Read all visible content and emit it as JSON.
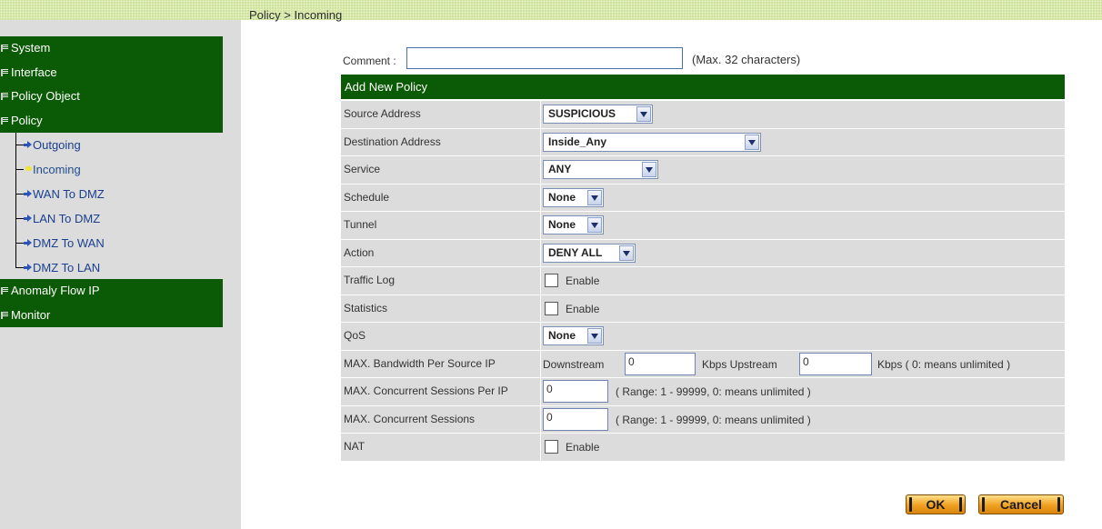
{
  "breadcrumb": "Policy > Incoming",
  "sidebar": {
    "top_items": [
      "System",
      "Interface",
      "Policy Object",
      "Policy"
    ],
    "sub_items": [
      {
        "label": "Outgoing",
        "active": false
      },
      {
        "label": "Incoming",
        "active": true
      },
      {
        "label": "WAN To DMZ",
        "active": false
      },
      {
        "label": "LAN To DMZ",
        "active": false
      },
      {
        "label": "DMZ To WAN",
        "active": false
      },
      {
        "label": "DMZ To LAN",
        "active": false
      }
    ],
    "bottom_items": [
      "Anomaly Flow IP",
      "Monitor"
    ]
  },
  "comment": {
    "label": "Comment :",
    "value": "",
    "hint": "(Max. 32 characters)"
  },
  "panel": {
    "title": "Add New Policy",
    "source_address": {
      "label": "Source Address",
      "value": "SUSPICIOUS"
    },
    "destination_address": {
      "label": "Destination Address",
      "value": "Inside_Any"
    },
    "service": {
      "label": "Service",
      "value": "ANY"
    },
    "schedule": {
      "label": "Schedule",
      "value": "None"
    },
    "tunnel": {
      "label": "Tunnel",
      "value": "None"
    },
    "action": {
      "label": "Action",
      "value": "DENY ALL"
    },
    "traffic_log": {
      "label": "Traffic Log",
      "checkbox_label": "Enable",
      "checked": false
    },
    "statistics": {
      "label": "Statistics",
      "checkbox_label": "Enable",
      "checked": false
    },
    "qos": {
      "label": "QoS",
      "value": "None"
    },
    "max_bandwidth": {
      "label": "MAX. Bandwidth Per Source IP",
      "downstream_label": "Downstream",
      "downstream_value": "0",
      "upstream_label": "Kbps Upstream",
      "upstream_value": "0",
      "hint": "Kbps ( 0: means unlimited )"
    },
    "max_sessions_per_ip": {
      "label": "MAX. Concurrent Sessions Per IP",
      "value": "0",
      "hint": "( Range: 1 - 99999, 0: means unlimited )"
    },
    "max_sessions": {
      "label": "MAX. Concurrent Sessions",
      "value": "0",
      "hint": "( Range: 1 - 99999, 0: means unlimited )"
    },
    "nat": {
      "label": "NAT",
      "checkbox_label": "Enable",
      "checked": false
    }
  },
  "buttons": {
    "ok": "OK",
    "cancel": "Cancel"
  },
  "colors": {
    "menu_green": "#0b5a05",
    "sidebar_gray": "#dcdcdc",
    "topbar_green": "#cfe39e",
    "button_orange": "#f0a020"
  }
}
